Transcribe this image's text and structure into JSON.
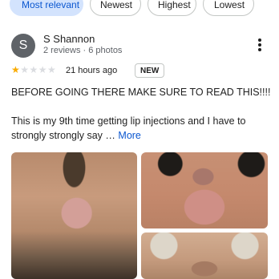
{
  "sort_chips": [
    {
      "label": "Most relevant",
      "active": true
    },
    {
      "label": "Newest",
      "active": false
    },
    {
      "label": "Highest",
      "active": false
    },
    {
      "label": "Lowest",
      "active": false
    }
  ],
  "review": {
    "avatar_letter": "S",
    "author": "S Shannon",
    "author_meta": "2 reviews · 6 photos",
    "rating": 1,
    "rating_max": 5,
    "stars_on": "★",
    "stars_off": "★★★★",
    "timestamp": "21 hours ago",
    "badge": "NEW",
    "title": "BEFORE GOING THERE MAKE SURE TO READ THIS!!!!",
    "body": "This is my 9th time getting lip injections and I have to strongly strongly say …",
    "more_label": "More"
  },
  "colors": {
    "accent": "#0b57d0",
    "active_chip_bg": "#d3e3fd",
    "star": "#f9ab00",
    "avatar_bg": "#5f6368"
  },
  "icons": {
    "overflow_menu": "more-vert-icon",
    "star": "star-icon"
  }
}
